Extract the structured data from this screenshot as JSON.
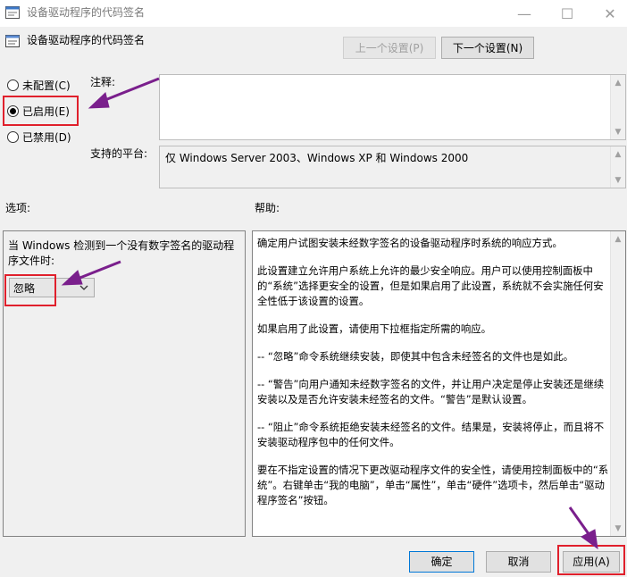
{
  "window": {
    "title": "设备驱动程序的代码签名",
    "minimize_glyph": "—",
    "maximize_glyph": "☐",
    "close_glyph": "✕"
  },
  "header": {
    "setting_name": "设备驱动程序的代码签名",
    "prev_button": "上一个设置(P)",
    "next_button": "下一个设置(N)"
  },
  "state": {
    "options": [
      {
        "label": "未配置(C)",
        "selected": false
      },
      {
        "label": "已启用(E)",
        "selected": true
      },
      {
        "label": "已禁用(D)",
        "selected": false
      }
    ]
  },
  "comment": {
    "label": "注释:",
    "value": ""
  },
  "platform": {
    "label": "支持的平台:",
    "value": "仅 Windows Server 2003、Windows XP 和 Windows 2000"
  },
  "options_section": {
    "title": "选项:",
    "prompt": "当 Windows 检测到一个没有数字签名的驱动程序文件时:",
    "dropdown_value": "忽略"
  },
  "help_section": {
    "title": "帮助:",
    "paragraphs": [
      "确定用户试图安装未经数字签名的设备驱动程序时系统的响应方式。",
      "此设置建立允许用户系统上允许的最少安全响应。用户可以使用控制面板中的“系统”选择更安全的设置，但是如果启用了此设置，系统就不会实施任何安全性低于该设置的设置。",
      "如果启用了此设置，请使用下拉框指定所需的响应。",
      "-- “忽略”命令系统继续安装，即使其中包含未经签名的文件也是如此。",
      "-- “警告”向用户通知未经数字签名的文件，并让用户决定是停止安装还是继续安装以及是否允许安装未经签名的文件。“警告”是默认设置。",
      "-- “阻止”命令系统拒绝安装未经签名的文件。结果是，安装将停止，而且将不安装驱动程序包中的任何文件。",
      "要在不指定设置的情况下更改驱动程序文件的安全性，请使用控制面板中的“系统”。右键单击“我的电脑”，单击“属性”，单击“硬件”选项卡，然后单击“驱动程序签名”按钮。"
    ]
  },
  "footer": {
    "ok": "确定",
    "cancel": "取消",
    "apply": "应用(A)"
  },
  "annotation_color": "#e0202c",
  "arrow_color": "#7a1f8c",
  "icons": [
    "app-icon",
    "policy-icon",
    "minimize-icon",
    "maximize-icon",
    "close-icon",
    "chevron-down-icon",
    "scroll-up-icon",
    "scroll-down-icon"
  ]
}
